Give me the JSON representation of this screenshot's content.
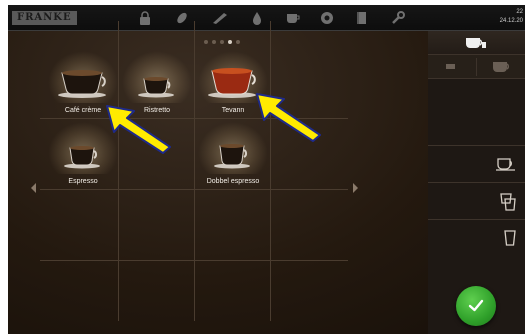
{
  "header": {
    "logo": "FRANKE",
    "icons": [
      "lock-icon",
      "leaf-icon",
      "brush-icon",
      "drop-icon",
      "cup-icon",
      "badge-icon",
      "book-icon",
      "wrench-icon"
    ],
    "time": "22",
    "date": "24.12.20"
  },
  "pager": {
    "pages": 5,
    "active": 4
  },
  "products": [
    {
      "label": "Café crème"
    },
    {
      "label": "Ristretto"
    },
    {
      "label": "Tevann"
    },
    {
      "label": "Espresso"
    },
    {
      "label": "Dobbel espresso"
    }
  ],
  "colors": {
    "accent_arrow": "#ffeb00",
    "ok_green": "#2fa02a",
    "tile_label": "#f4efe8"
  },
  "right_panel": {
    "sizes": [
      "cup-saucer-icon",
      "large-cup-icon",
      "glass-icon"
    ]
  }
}
